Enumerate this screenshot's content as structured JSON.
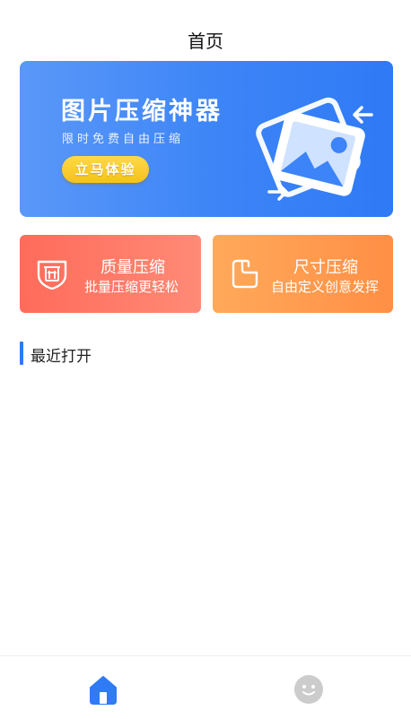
{
  "header": {
    "title": "首页"
  },
  "banner": {
    "title": "图片压缩神器",
    "subtitle": "限时免费自由压缩",
    "cta_label": "立马体验",
    "illustration_icon": "image-rotate-icon"
  },
  "features": [
    {
      "title": "质量压缩",
      "desc": "批量压缩更轻松",
      "icon": "quality-shield-icon",
      "color": "#ff6b5a"
    },
    {
      "title": "尺寸压缩",
      "desc": "自由定义创意发挥",
      "icon": "size-crop-icon",
      "color": "#ffa95a"
    }
  ],
  "recent": {
    "title": "最近打开",
    "accent": "#2f7af5"
  },
  "tabbar": {
    "items": [
      {
        "name": "home",
        "icon": "home-icon",
        "active": true,
        "color": "#2f7af5"
      },
      {
        "name": "mine",
        "icon": "face-icon",
        "active": false,
        "color": "#cccccc"
      }
    ]
  }
}
